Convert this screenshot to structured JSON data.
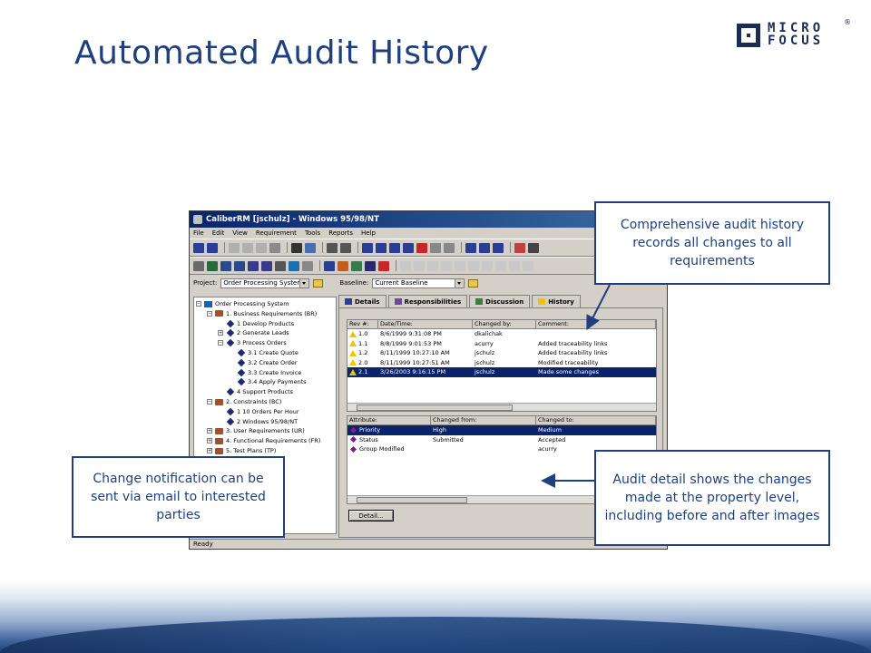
{
  "slide": {
    "title": "Automated Audit History",
    "logo": {
      "line1": "MICRO",
      "line2": "FOCUS",
      "reg": "®"
    }
  },
  "window": {
    "title": "CaliberRM [jschulz] - Windows 95/98/NT",
    "menu": [
      "File",
      "Edit",
      "View",
      "Requirement",
      "Tools",
      "Reports",
      "Help"
    ],
    "project_label": "Project:",
    "project_value": "Order Processing System",
    "baseline_label": "Baseline:",
    "baseline_value": "Current Baseline",
    "status": "Ready"
  },
  "tree": [
    {
      "label": "Order Processing System",
      "level": 0,
      "icon": "root",
      "exp": "minus"
    },
    {
      "label": "1. Business Requirements (BR)",
      "level": 1,
      "icon": "book",
      "exp": "minus"
    },
    {
      "label": "1 Develop Products",
      "level": 2,
      "icon": "req",
      "exp": ""
    },
    {
      "label": "2 Generate Leads",
      "level": 2,
      "icon": "req",
      "exp": "plus"
    },
    {
      "label": "3 Process Orders",
      "level": 2,
      "icon": "req",
      "exp": "minus"
    },
    {
      "label": "3.1 Create Quote",
      "level": 3,
      "icon": "req",
      "exp": ""
    },
    {
      "label": "3.2 Create Order",
      "level": 3,
      "icon": "req",
      "exp": ""
    },
    {
      "label": "3.3 Create Invoice",
      "level": 3,
      "icon": "req",
      "exp": ""
    },
    {
      "label": "3.4 Apply Payments",
      "level": 3,
      "icon": "req",
      "exp": ""
    },
    {
      "label": "4 Support Products",
      "level": 2,
      "icon": "req",
      "exp": ""
    },
    {
      "label": "2. Constraints (BC)",
      "level": 1,
      "icon": "book",
      "exp": "minus"
    },
    {
      "label": "1 10 Orders Per Hour",
      "level": 2,
      "icon": "req",
      "exp": ""
    },
    {
      "label": "2 Windows 95/98/NT",
      "level": 2,
      "icon": "req",
      "exp": ""
    },
    {
      "label": "3. User Requirements (UR)",
      "level": 1,
      "icon": "book",
      "exp": "plus"
    },
    {
      "label": "4. Functional Requirements (FR)",
      "level": 1,
      "icon": "book",
      "exp": "plus"
    },
    {
      "label": "5. Test Plans (TP)",
      "level": 1,
      "icon": "book",
      "exp": "plus"
    }
  ],
  "tabs": [
    {
      "label": "Details",
      "color": "#2c3e8f"
    },
    {
      "label": "Responsibilities",
      "color": "#6a4a9a"
    },
    {
      "label": "Discussion",
      "color": "#3a7d44"
    },
    {
      "label": "History",
      "color": "#f2c200"
    }
  ],
  "history": {
    "headers": [
      "Rev #:",
      "Date/Time:",
      "Changed by:",
      "Comment:"
    ],
    "rows": [
      [
        "1.0",
        "8/6/1999  9:31:08 PM",
        "dkalichak",
        ""
      ],
      [
        "1.1",
        "8/8/1999  9:01:53 PM",
        "acurry",
        "Added traceability links"
      ],
      [
        "1.2",
        "8/11/1999  10:27:10 AM",
        "jschulz",
        "Added traceability links"
      ],
      [
        "2.0",
        "8/11/1999  10:27:51 AM",
        "jschulz",
        "Modified traceability"
      ],
      [
        "2.1",
        "3/26/2003  9:16:15 PM",
        "jschulz",
        "Made some changes"
      ]
    ],
    "selected_row": 4
  },
  "detail": {
    "headers": [
      "Attribute:",
      "Changed from:",
      "Changed to:"
    ],
    "rows": [
      [
        "Priority",
        "High",
        "Medium"
      ],
      [
        "Status",
        "Submitted",
        "Accepted"
      ],
      [
        "Group Modified",
        "",
        "acurry"
      ]
    ],
    "selected_row": 0,
    "button": "Detail..."
  },
  "callouts": {
    "top_right": "Comprehensive audit history records all changes to all requirements",
    "left": "Change notification can be sent via email to interested parties",
    "bottom_right": "Audit detail shows the changes made at the property level, including before and after images"
  },
  "colors": {
    "title": "#1f3f7f",
    "selection": "#0a246a",
    "callout_border": "#1f3f7f"
  }
}
